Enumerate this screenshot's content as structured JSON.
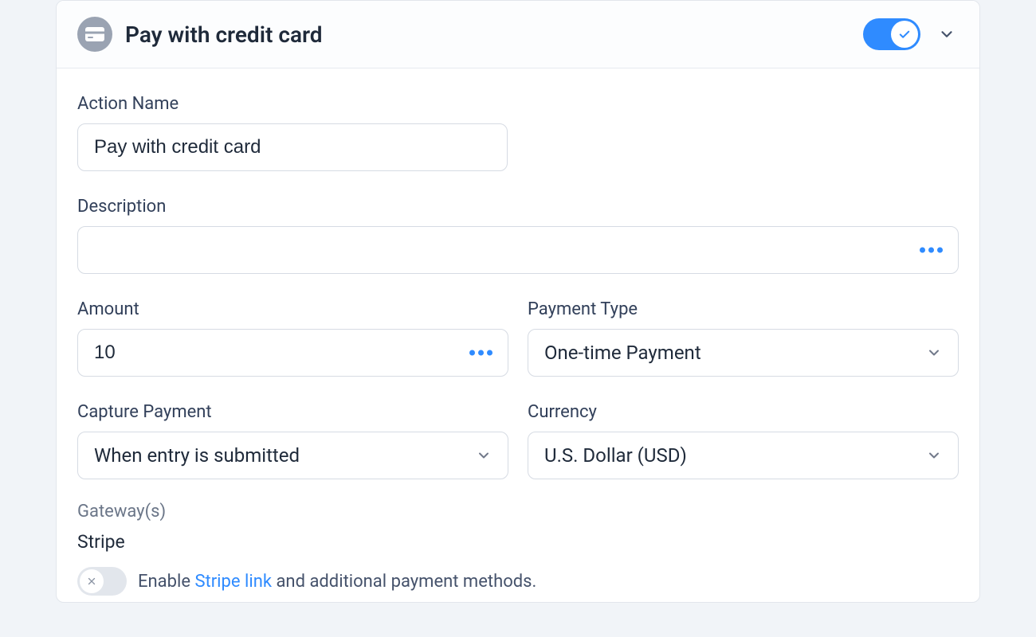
{
  "header": {
    "title": "Pay with credit card",
    "toggle_on": true
  },
  "form": {
    "action_name_label": "Action Name",
    "action_name_value": "Pay with credit card",
    "description_label": "Description",
    "description_value": "",
    "amount_label": "Amount",
    "amount_value": "10",
    "payment_type_label": "Payment Type",
    "payment_type_value": "One-time Payment",
    "capture_payment_label": "Capture Payment",
    "capture_payment_value": "When entry is submitted",
    "currency_label": "Currency",
    "currency_value": "U.S. Dollar (USD)"
  },
  "gateway": {
    "label": "Gateway(s)",
    "name": "Stripe",
    "enable_prefix": "Enable ",
    "link_text": "Stripe link",
    "enable_suffix": " and additional payment methods.",
    "link_toggle_on": false
  }
}
